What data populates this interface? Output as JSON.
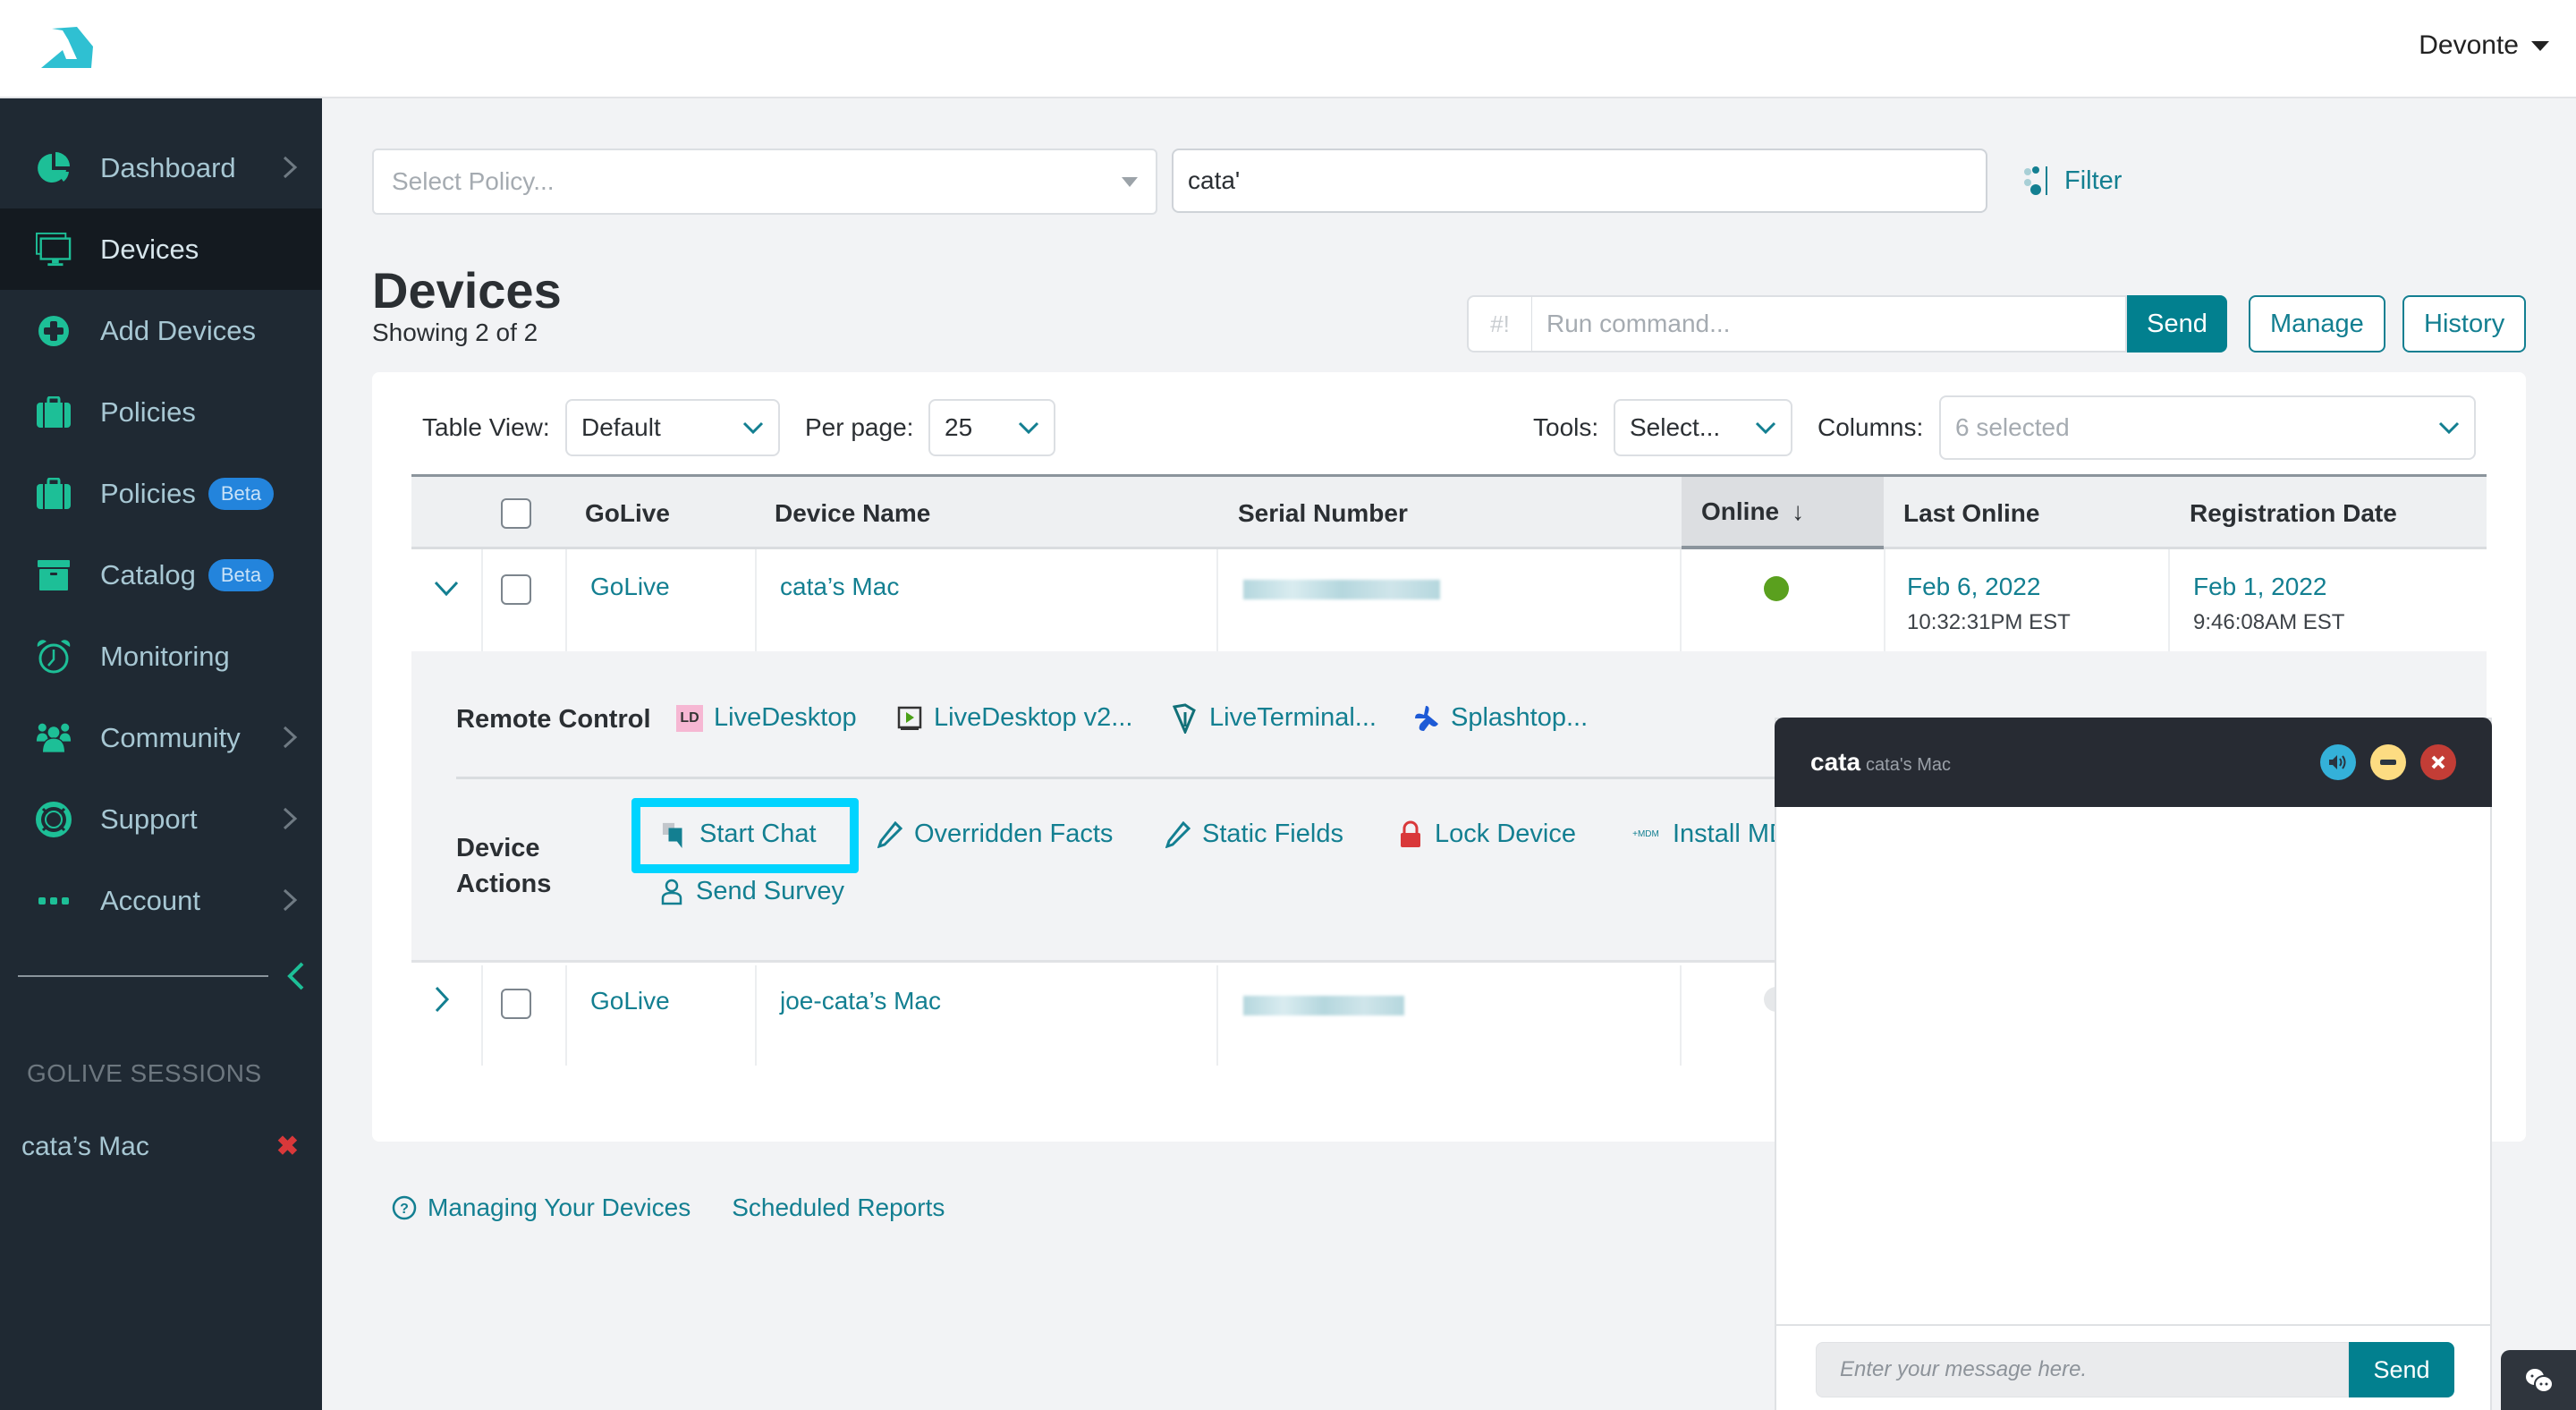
{
  "header": {
    "user_name": "Devonte"
  },
  "sidebar": {
    "items": [
      {
        "label": "Dashboard",
        "icon": "pie-chart-icon",
        "has_submenu": true
      },
      {
        "label": "Devices",
        "icon": "monitor-icon",
        "active": true
      },
      {
        "label": "Add Devices",
        "icon": "plus-circle-icon"
      },
      {
        "label": "Policies",
        "icon": "briefcase-icon"
      },
      {
        "label": "Policies",
        "icon": "briefcase-icon",
        "badge": "Beta"
      },
      {
        "label": "Catalog",
        "icon": "archive-box-icon",
        "badge": "Beta"
      },
      {
        "label": "Monitoring",
        "icon": "alarm-clock-icon"
      },
      {
        "label": "Community",
        "icon": "users-icon",
        "has_submenu": true
      },
      {
        "label": "Support",
        "icon": "life-ring-icon",
        "has_submenu": true
      },
      {
        "label": "Account",
        "icon": "ellipsis-icon",
        "has_submenu": true
      }
    ],
    "sessions_title": "GOLIVE SESSIONS",
    "sessions": [
      {
        "name": "cata’s Mac"
      }
    ],
    "session_close_glyph": "✖"
  },
  "filters": {
    "policy_placeholder": "Select Policy...",
    "search_value": "cata'",
    "filter_label": "Filter"
  },
  "page": {
    "title": "Devices",
    "subtitle": "Showing 2 of 2"
  },
  "command": {
    "prefix": "#!",
    "placeholder": "Run command...",
    "send_label": "Send",
    "manage_label": "Manage",
    "history_label": "History"
  },
  "table_toolbar": {
    "table_view_label": "Table View:",
    "table_view_value": "Default",
    "per_page_label": "Per page:",
    "per_page_value": "25",
    "tools_label": "Tools:",
    "tools_value": "Select...",
    "columns_label": "Columns:",
    "columns_value": "6 selected"
  },
  "table": {
    "columns": [
      "GoLive",
      "Device Name",
      "Serial Number",
      "Online",
      "Last Online",
      "Registration Date"
    ],
    "sort_indicator": "↓",
    "rows": [
      {
        "expanded": true,
        "golive": "GoLive",
        "device_name": "cata’s Mac",
        "serial_redacted": true,
        "online": true,
        "last_online_date": "Feb 6, 2022",
        "last_online_time": "10:32:31PM EST",
        "registration_date": "Feb 1, 2022",
        "registration_time": "9:46:08AM EST"
      },
      {
        "expanded": false,
        "golive": "GoLive",
        "device_name": "joe-cata’s Mac",
        "serial_redacted": true,
        "online": false
      }
    ]
  },
  "expand_panel": {
    "remote_control_label": "Remote Control",
    "remote_control": [
      {
        "label": "LiveDesktop",
        "icon": "livedesktop-icon"
      },
      {
        "label": "LiveDesktop v2...",
        "icon": "play-screen-icon"
      },
      {
        "label": "LiveTerminal...",
        "icon": "terminal-icon"
      },
      {
        "label": "Splashtop...",
        "icon": "splashtop-icon"
      }
    ],
    "device_actions_label_1": "Device",
    "device_actions_label_2": "Actions",
    "device_actions": [
      {
        "label": "Start Chat",
        "icon": "chat-icon",
        "highlighted": true
      },
      {
        "label": "Overridden Facts",
        "icon": "pencil-icon"
      },
      {
        "label": "Static Fields",
        "icon": "pencil-icon"
      },
      {
        "label": "Lock Device",
        "icon": "lock-icon"
      },
      {
        "label": "Install MDM",
        "icon": "mdm-icon"
      },
      {
        "label": "Send Survey",
        "icon": "user-icon"
      }
    ]
  },
  "footer": {
    "help_link": "Managing Your Devices",
    "reports_link": "Scheduled Reports"
  },
  "chat": {
    "user": "cata",
    "device": "cata's Mac",
    "placeholder": "Enter your message here.",
    "send_label": "Send"
  },
  "colors": {
    "accent": "#02808f",
    "link": "#137f91",
    "sidebar_bg": "#1f2933",
    "sidebar_icon": "#1dbf97",
    "highlight": "#00d4ff",
    "online": "#5aa01e",
    "beta_badge": "#2384dc"
  }
}
